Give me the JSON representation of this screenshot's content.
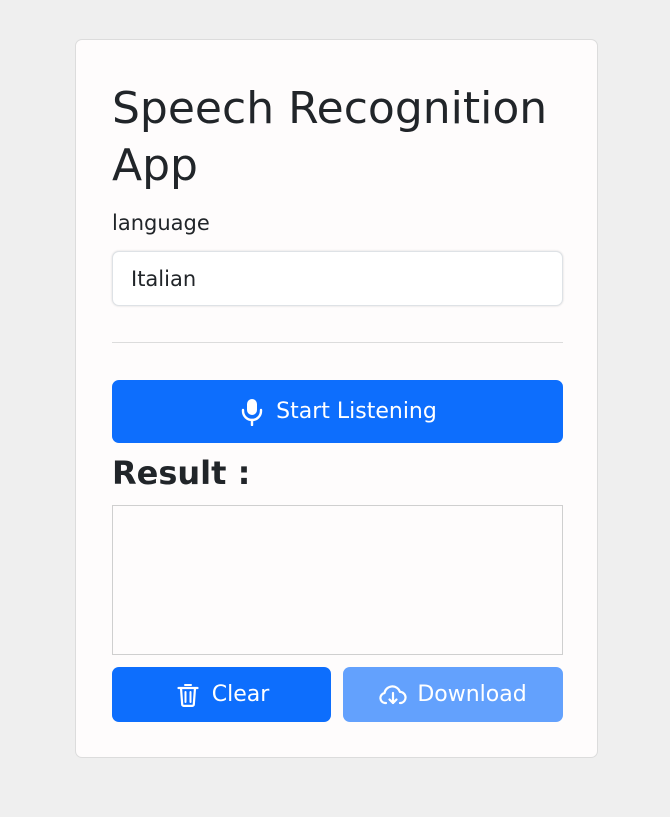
{
  "app": {
    "title": "Speech Recognition App"
  },
  "language": {
    "label": "language",
    "selected": "Italian"
  },
  "controls": {
    "start_label": "Start Listening",
    "start_icon": "microphone-icon"
  },
  "result": {
    "heading": "Result :",
    "text": ""
  },
  "actions": {
    "clear_label": "Clear",
    "clear_icon": "trash-icon",
    "download_label": "Download",
    "download_icon": "cloud-download-icon"
  },
  "colors": {
    "background": "#efefef",
    "card": "#fefcfc",
    "primary": "#0d6efd",
    "primary_disabled": "#63a1fd",
    "text": "#212529"
  }
}
